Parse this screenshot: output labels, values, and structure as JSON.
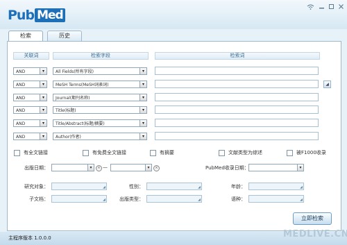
{
  "app": {
    "logo_pub": "Pub",
    "logo_med": "Med"
  },
  "window_controls": {
    "wifi": "wifi-icon",
    "minimize": "minimize-icon",
    "maximize": "maximize-icon",
    "close": "close-icon"
  },
  "tabs": [
    {
      "label": "检索"
    },
    {
      "label": "历史"
    }
  ],
  "columns": {
    "relation": "关联词",
    "field": "检索字段",
    "term": "检索词"
  },
  "rows": [
    {
      "op": "AND",
      "field": "All Fields(所有字段)"
    },
    {
      "op": "AND",
      "field": "MeSH Terms(MeSH词表词)"
    },
    {
      "op": "AND",
      "field": "Journal(期刊名称)"
    },
    {
      "op": "AND",
      "field": "Title(标题)"
    },
    {
      "op": "AND",
      "field": "Title/Abstract(标题/摘要)"
    },
    {
      "op": "AND",
      "field": "Author(作者)"
    }
  ],
  "checkboxes": [
    "有全文链接",
    "有免费全文链接",
    "有摘要",
    "文献类型为综述",
    "被F1000收录"
  ],
  "filters": {
    "pub_date": "出版日期：",
    "dash": "—",
    "pubmed_date": "PubMed收录日期：",
    "subject": "研究对象：",
    "sex": "性别：",
    "age": "年龄：",
    "subset": "子文档：",
    "pub_type": "出版类型：",
    "language": "语种："
  },
  "search_button": "立即检索",
  "status": "主程序版本 1.0.0.0",
  "watermark": "MEDLIVE.CN"
}
